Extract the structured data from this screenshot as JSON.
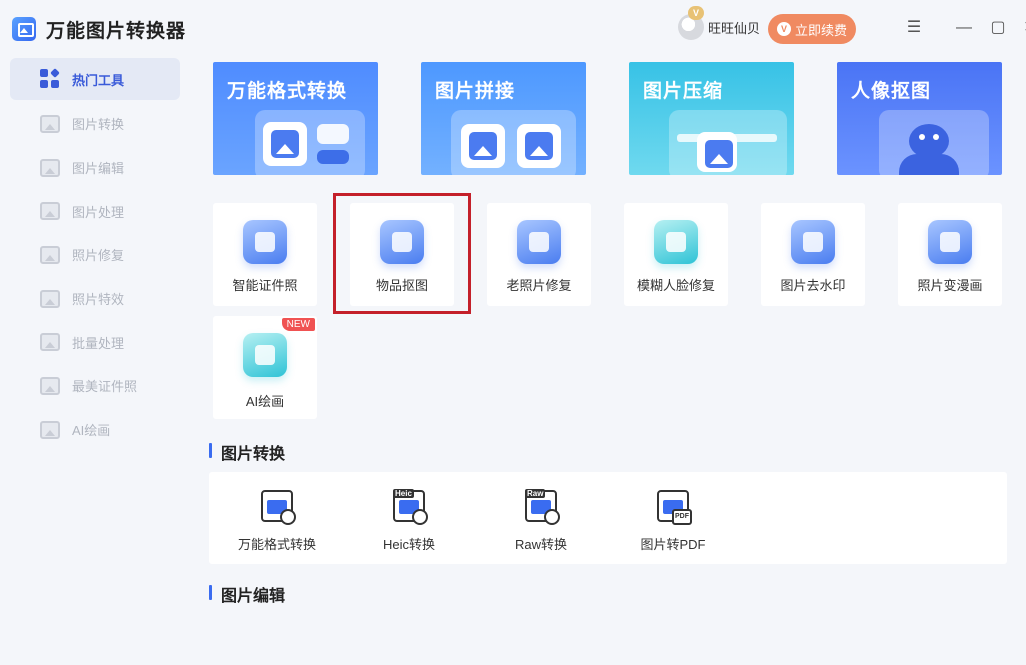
{
  "app": {
    "title": "万能图片转换器"
  },
  "sidebar": {
    "items": [
      {
        "label": "热门工具",
        "icon": "grid-icon",
        "active": true
      },
      {
        "label": "图片转换",
        "icon": "image-convert-icon"
      },
      {
        "label": "图片编辑",
        "icon": "image-edit-icon"
      },
      {
        "label": "图片处理",
        "icon": "image-process-icon"
      },
      {
        "label": "照片修复",
        "icon": "photo-repair-icon"
      },
      {
        "label": "照片特效",
        "icon": "photo-effect-icon"
      },
      {
        "label": "批量处理",
        "icon": "batch-icon"
      },
      {
        "label": "最美证件照",
        "icon": "id-photo-icon"
      },
      {
        "label": "AI绘画",
        "icon": "ai-paint-icon"
      }
    ]
  },
  "topbar": {
    "username": "旺旺仙贝",
    "vip_badge": "V",
    "renew_label": "立即续费",
    "renew_icon_glyph": "V",
    "menu_glyph": "☰",
    "minimize_glyph": "—",
    "maximize_glyph": "▢",
    "close_glyph": "✕"
  },
  "banners": [
    {
      "label": "万能格式转换"
    },
    {
      "label": "图片拼接"
    },
    {
      "label": "图片压缩"
    },
    {
      "label": "人像抠图"
    }
  ],
  "tools": [
    {
      "label": "智能证件照",
      "icon": "id-card-icon"
    },
    {
      "label": "物品抠图",
      "icon": "bag-cutout-icon"
    },
    {
      "label": "老照片修复",
      "icon": "photo-repair-tool-icon"
    },
    {
      "label": "模糊人脸修复",
      "icon": "face-repair-icon"
    },
    {
      "label": "图片去水印",
      "icon": "watermark-remove-icon"
    },
    {
      "label": "照片变漫画",
      "icon": "cartoon-icon"
    },
    {
      "label": "AI绘画",
      "icon": "ai-paint-tool-icon",
      "badge": "NEW"
    }
  ],
  "sections": {
    "convert_title": "图片转换",
    "edit_title": "图片编辑"
  },
  "converters": [
    {
      "label": "万能格式转换",
      "tag": ""
    },
    {
      "label": "Heic转换",
      "tag": "Heic"
    },
    {
      "label": "Raw转换",
      "tag": "Raw"
    },
    {
      "label": "图片转PDF",
      "tag": "PDF"
    }
  ],
  "colors": {
    "accent": "#3a6cf0",
    "renew": "#f08a61",
    "highlight_box": "#c4202a",
    "new_badge": "#f05252"
  }
}
